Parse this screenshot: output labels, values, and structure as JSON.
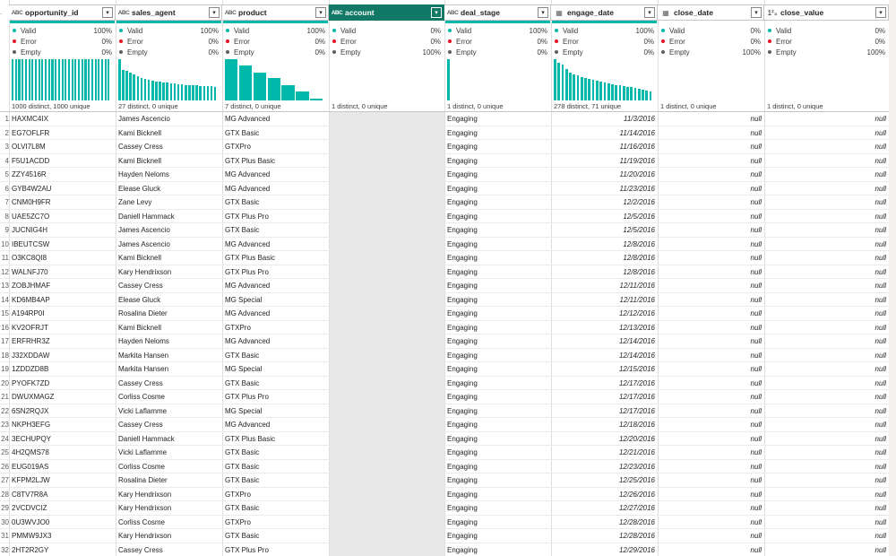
{
  "columns": [
    {
      "name": "opportunity_id",
      "type_icon": "A B C",
      "type_label": "ABC",
      "filter_icon": "▾",
      "valid": "100%",
      "error": "0%",
      "empty": "0%",
      "summary": "1000 distinct, 1000 unique",
      "dist": [
        1,
        1,
        1,
        1,
        1,
        1,
        1,
        1,
        1,
        1,
        1,
        1,
        1,
        1,
        1,
        1,
        1,
        1,
        1,
        1,
        1,
        1,
        1,
        1,
        1,
        1,
        1,
        1,
        1,
        1
      ]
    },
    {
      "name": "sales_agent",
      "type_label": "ABC",
      "filter_icon": "▾",
      "valid": "100%",
      "error": "0%",
      "empty": "0%",
      "summary": "27 distinct, 0 unique",
      "dist": [
        1,
        0.74,
        0.72,
        0.68,
        0.62,
        0.58,
        0.55,
        0.52,
        0.5,
        0.48,
        0.46,
        0.45,
        0.44,
        0.43,
        0.42,
        0.41,
        0.4,
        0.39,
        0.38,
        0.38,
        0.37,
        0.36,
        0.35,
        0.35,
        0.34,
        0.34,
        0.33
      ]
    },
    {
      "name": "product",
      "type_label": "ABC",
      "filter_icon": "▾",
      "valid": "100%",
      "error": "0%",
      "empty": "0%",
      "summary": "7 distinct, 0 unique",
      "dist": [
        1,
        0.84,
        0.68,
        0.54,
        0.38,
        0.22,
        0.05
      ]
    },
    {
      "name": "account",
      "type_label": "ABC",
      "filter_icon": "▾",
      "valid": "0%",
      "error": "0%",
      "empty": "100%",
      "summary": "1 distinct, 0 unique",
      "dist": []
    },
    {
      "name": "deal_stage",
      "type_label": "ABC",
      "filter_icon": "▾",
      "valid": "100%",
      "error": "0%",
      "empty": "0%",
      "summary": "1 distinct, 0 unique",
      "dist": [
        1
      ]
    },
    {
      "name": "engage_date",
      "type_label": "CAL",
      "filter_icon": "▾",
      "valid": "100%",
      "error": "0%",
      "empty": "0%",
      "summary": "278 distinct, 71 unique",
      "dist": [
        1,
        0.92,
        0.88,
        0.76,
        0.68,
        0.64,
        0.6,
        0.56,
        0.54,
        0.52,
        0.5,
        0.48,
        0.46,
        0.44,
        0.42,
        0.4,
        0.38,
        0.36,
        0.34,
        0.33,
        0.32,
        0.3,
        0.28,
        0.26,
        0.24,
        0.22
      ]
    },
    {
      "name": "close_date",
      "type_label": "CAL",
      "filter_icon": "▾",
      "valid": "0%",
      "error": "0%",
      "empty": "100%",
      "summary": "1 distinct, 0 unique",
      "dist": []
    },
    {
      "name": "close_value",
      "type_label": "123",
      "filter_icon": "▾",
      "valid": "0%",
      "error": "0%",
      "empty": "100%",
      "summary": "1 distinct, 0 unique",
      "dist": []
    }
  ],
  "labels": {
    "valid": "Valid",
    "error": "Error",
    "empty": "Empty",
    "null": "null"
  },
  "rows": [
    [
      "HAXMC4IX",
      "James Ascencio",
      "MG Advanced",
      "",
      "Engaging",
      "11/3/2016"
    ],
    [
      "EG7OFLFR",
      "Kami Bicknell",
      "GTX Basic",
      "",
      "Engaging",
      "11/14/2016"
    ],
    [
      "OLVI7L8M",
      "Cassey Cress",
      "GTXPro",
      "",
      "Engaging",
      "11/16/2016"
    ],
    [
      "F5U1ACDD",
      "Kami Bicknell",
      "GTX Plus Basic",
      "",
      "Engaging",
      "11/19/2016"
    ],
    [
      "ZZY4516R",
      "Hayden Neloms",
      "MG Advanced",
      "",
      "Engaging",
      "11/20/2016"
    ],
    [
      "GYB4W2AU",
      "Elease Gluck",
      "MG Advanced",
      "",
      "Engaging",
      "11/23/2016"
    ],
    [
      "CNM0H9FR",
      "Zane Levy",
      "GTX Basic",
      "",
      "Engaging",
      "12/2/2016"
    ],
    [
      "UAE5ZC7O",
      "Daniell Hammack",
      "GTX Plus Pro",
      "",
      "Engaging",
      "12/5/2016"
    ],
    [
      "JUCNIG4H",
      "James Ascencio",
      "GTX Basic",
      "",
      "Engaging",
      "12/5/2016"
    ],
    [
      "IBEUTCSW",
      "James Ascencio",
      "MG Advanced",
      "",
      "Engaging",
      "12/8/2016"
    ],
    [
      "O3KC8QI8",
      "Kami Bicknell",
      "GTX Plus Basic",
      "",
      "Engaging",
      "12/8/2016"
    ],
    [
      "WALNFJ70",
      "Kary Hendrixson",
      "GTX Plus Pro",
      "",
      "Engaging",
      "12/8/2016"
    ],
    [
      "ZOBJHMAF",
      "Cassey Cress",
      "MG Advanced",
      "",
      "Engaging",
      "12/11/2016"
    ],
    [
      "KD6MB4AP",
      "Elease Gluck",
      "MG Special",
      "",
      "Engaging",
      "12/11/2016"
    ],
    [
      "A194RP0I",
      "Rosalina Dieter",
      "MG Advanced",
      "",
      "Engaging",
      "12/12/2016"
    ],
    [
      "KV2OFRJT",
      "Kami Bicknell",
      "GTXPro",
      "",
      "Engaging",
      "12/13/2016"
    ],
    [
      "ERFRHR3Z",
      "Hayden Neloms",
      "MG Advanced",
      "",
      "Engaging",
      "12/14/2016"
    ],
    [
      "J32XDDAW",
      "Markita Hansen",
      "GTX Basic",
      "",
      "Engaging",
      "12/14/2016"
    ],
    [
      "1ZDDZD8B",
      "Markita Hansen",
      "MG Special",
      "",
      "Engaging",
      "12/15/2016"
    ],
    [
      "PYOFK7ZD",
      "Cassey Cress",
      "GTX Basic",
      "",
      "Engaging",
      "12/17/2016"
    ],
    [
      "DWUXMAGZ",
      "Corliss Cosme",
      "GTX Plus Pro",
      "",
      "Engaging",
      "12/17/2016"
    ],
    [
      "6SN2RQJX",
      "Vicki Laflamme",
      "MG Special",
      "",
      "Engaging",
      "12/17/2016"
    ],
    [
      "NKPH3EFG",
      "Cassey Cress",
      "MG Advanced",
      "",
      "Engaging",
      "12/18/2016"
    ],
    [
      "3ECHUPQY",
      "Daniell Hammack",
      "GTX Plus Basic",
      "",
      "Engaging",
      "12/20/2016"
    ],
    [
      "4H2QMS78",
      "Vicki Laflamme",
      "GTX Basic",
      "",
      "Engaging",
      "12/21/2016"
    ],
    [
      "EUG019AS",
      "Corliss Cosme",
      "GTX Basic",
      "",
      "Engaging",
      "12/23/2016"
    ],
    [
      "KFPM2LJW",
      "Rosalina Dieter",
      "GTX Basic",
      "",
      "Engaging",
      "12/25/2016"
    ],
    [
      "C8TV7R8A",
      "Kary Hendrixson",
      "GTXPro",
      "",
      "Engaging",
      "12/26/2016"
    ],
    [
      "2VCDVCIZ",
      "Kary Hendrixson",
      "GTX Basic",
      "",
      "Engaging",
      "12/27/2016"
    ],
    [
      "0U3WVJO0",
      "Corliss Cosme",
      "GTXPro",
      "",
      "Engaging",
      "12/28/2016"
    ],
    [
      "PMMW9JX3",
      "Kary Hendrixson",
      "GTX Basic",
      "",
      "Engaging",
      "12/28/2016"
    ],
    [
      "2HT2R2GY",
      "Cassey Cress",
      "GTX Plus Pro",
      "",
      "Engaging",
      "12/29/2016"
    ]
  ],
  "row_numbers": [
    "1",
    "2",
    "3",
    "4",
    "5",
    "6",
    "7",
    "8",
    "9",
    "10",
    "11",
    "12",
    "13",
    "14",
    "15",
    "16",
    "17",
    "18",
    "19",
    "20",
    "21",
    "22",
    "23",
    "24",
    "25",
    "26",
    "27",
    "28",
    "29",
    "30",
    "31",
    "32"
  ],
  "selected_column": "account",
  "colors": {
    "accent": "#01b8aa",
    "selected_header": "#117865",
    "error": "#e81123"
  }
}
